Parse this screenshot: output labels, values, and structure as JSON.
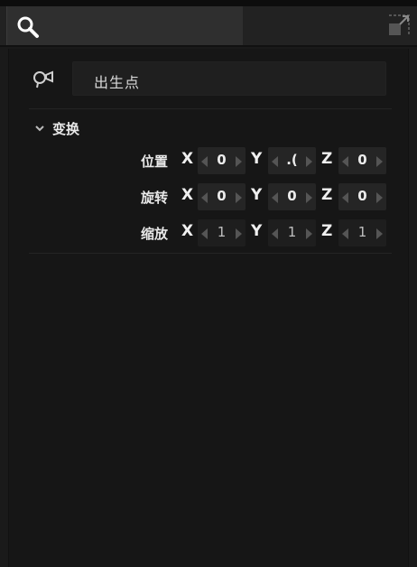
{
  "icons": {
    "search": "search-icon",
    "maximize": "maximize-icon",
    "node": "node-type-icon",
    "collapse": "chevron-down-icon"
  },
  "node": {
    "name": "出生点"
  },
  "transform": {
    "title": "变换",
    "rows": [
      {
        "label": "位置",
        "x": "0",
        "y": ".(",
        "z": "0"
      },
      {
        "label": "旋转",
        "x": "0",
        "y": "0",
        "z": "0"
      },
      {
        "label": "缩放",
        "x": "1",
        "y": "1",
        "z": "1"
      }
    ],
    "axes": {
      "x": "X",
      "y": "Y",
      "z": "Z"
    }
  }
}
